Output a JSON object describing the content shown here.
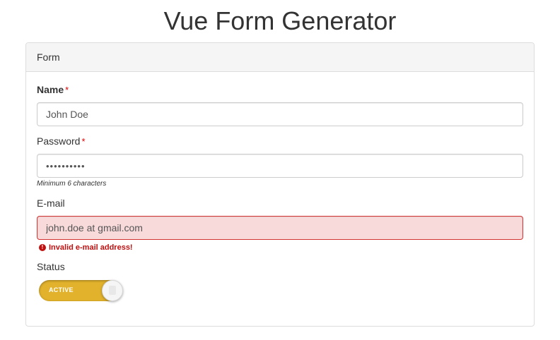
{
  "page": {
    "title": "Vue Form Generator"
  },
  "panel": {
    "heading": "Form"
  },
  "fields": {
    "name": {
      "label": "Name",
      "required_mark": "*",
      "value": "John Doe"
    },
    "password": {
      "label": "Password",
      "required_mark": "*",
      "value": "••••••••••",
      "hint": "Minimum 6 characters"
    },
    "email": {
      "label": "E-mail",
      "value": "john.doe at gmail.com",
      "error": "Invalid e-mail address!",
      "error_icon": "!"
    },
    "status": {
      "label": "Status",
      "switch_text": "ACTIVE",
      "checked": true
    }
  },
  "colors": {
    "switch_on": "#e2b22c",
    "error_bg": "#f9dada",
    "error_border": "#d23232",
    "error_text": "#c01010",
    "required_mark": "#e00000"
  }
}
